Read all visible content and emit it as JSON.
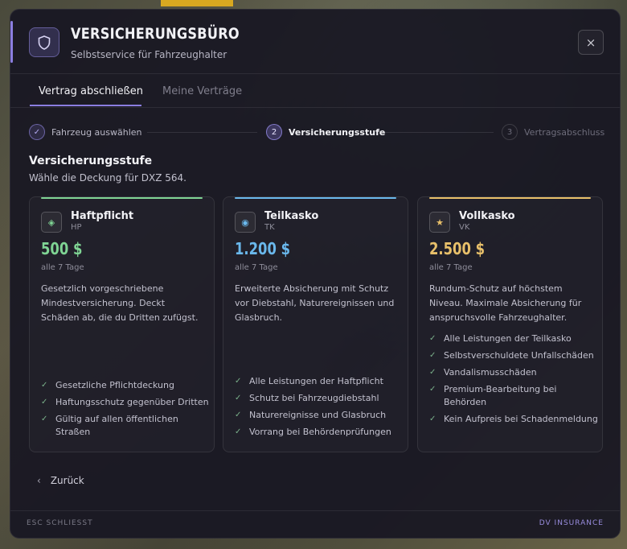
{
  "header": {
    "title": "VERSICHERUNGSBÜRO",
    "subtitle": "Selbstservice für Fahrzeughalter",
    "close_label": "×"
  },
  "tabs": [
    {
      "label": "Vertrag abschließen",
      "active": true
    },
    {
      "label": "Meine Verträge",
      "active": false
    }
  ],
  "steps": [
    {
      "number": "✓",
      "label": "Fahrzeug auswählen",
      "state": "done"
    },
    {
      "number": "2",
      "label": "Versicherungsstufe",
      "state": "active"
    },
    {
      "number": "3",
      "label": "Vertragsabschluss",
      "state": "pending"
    }
  ],
  "section": {
    "title": "Versicherungsstufe",
    "subtitle": "Wähle die Deckung für DXZ 564."
  },
  "cards": [
    {
      "name": "Haftpflicht",
      "code": "HP",
      "price": "500 $",
      "period": "alle 7 Tage",
      "color": "#7fd494",
      "icon": "diamond-icon",
      "icon_glyph": "◈",
      "description": "Gesetzlich vorgeschriebene Mindestversicherung. Deckt Schäden ab, die du Dritten zufügst.",
      "features": [
        "Gesetzliche Pflichtdeckung",
        "Haftungsschutz gegenüber Dritten",
        "Gültig auf allen öffentlichen Straßen"
      ]
    },
    {
      "name": "Teilkasko",
      "code": "TK",
      "price": "1.200 $",
      "period": "alle 7 Tage",
      "color": "#6ab8ec",
      "icon": "dot-circle-icon",
      "icon_glyph": "◉",
      "description": "Erweiterte Absicherung mit Schutz vor Diebstahl, Naturereignissen und Glasbruch.",
      "features": [
        "Alle Leistungen der Haftpflicht",
        "Schutz bei Fahrzeugdiebstahl",
        "Naturereignisse und Glasbruch",
        "Vorrang bei Behördenprüfungen"
      ]
    },
    {
      "name": "Vollkasko",
      "code": "VK",
      "price": "2.500 $",
      "period": "alle 7 Tage",
      "color": "#e8c06a",
      "icon": "star-icon",
      "icon_glyph": "★",
      "description": "Rundum-Schutz auf höchstem Niveau. Maximale Absicherung für anspruchsvolle Fahrzeughalter.",
      "features": [
        "Alle Leistungen der Teilkasko",
        "Selbstverschuldete Unfallschäden",
        "Vandalismusschäden",
        "Premium-Bearbeitung bei Behörden",
        "Kein Aufpreis bei Schadenmeldung"
      ]
    }
  ],
  "back_label": "Zurück",
  "footer": {
    "left": "ESC SCHLIESST",
    "right": "DV INSURANCE"
  },
  "colors": {
    "accent": "#8b7ee0",
    "check": "#7ab08a"
  }
}
